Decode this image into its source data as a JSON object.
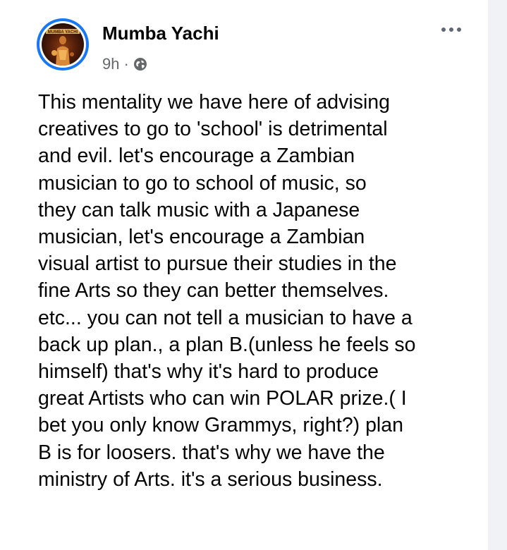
{
  "post": {
    "author": "Mumba Yachi",
    "time": "9h",
    "separator": "·",
    "audience_icon": "globe-icon",
    "more_icon": "more-dots-icon",
    "avatar_text": "MUMBA YACHI",
    "text_lines": [
      "This mentality we have here of advising",
      "creatives to go to 'school' is detrimental",
      "and evil. let's encourage a Zambian",
      "musician to go to school of music, so",
      "they can talk music with a Japanese",
      "musician, let's encourage a Zambian",
      "visual artist to pursue their studies in the",
      "fine Arts so they can better themselves.",
      "etc... you can not tell a musician to have a",
      "back up plan., a plan B.(unless he feels so",
      "himself) that's why it's hard to produce",
      "great Artists who can win POLAR prize.( I",
      "bet you only know Grammys, right?) plan",
      "B is for loosers. that's why we have the",
      "ministry of Arts. it's a serious business."
    ]
  },
  "colors": {
    "accent": "#1877f2",
    "text": "#050505",
    "secondary_text": "#65676b",
    "background": "#ffffff",
    "gutter": "#f0f2f5"
  }
}
